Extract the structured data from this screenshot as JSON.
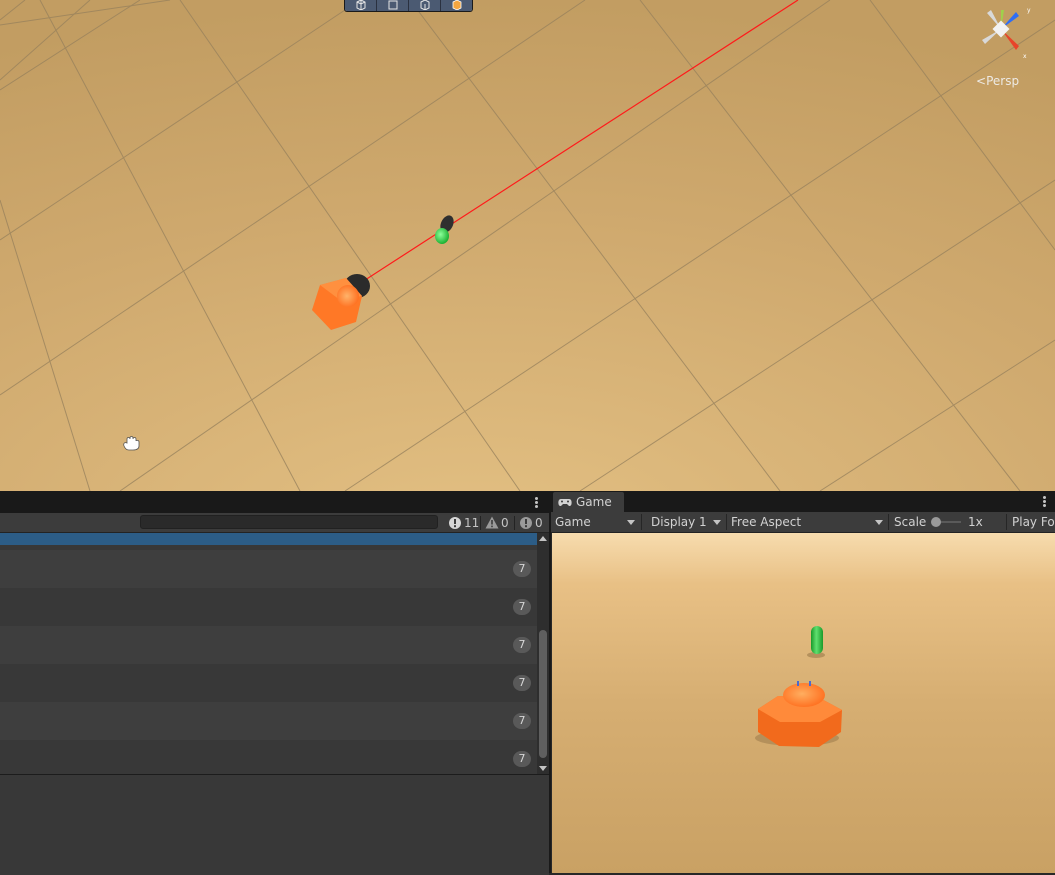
{
  "scene": {
    "persp_label": "Persp",
    "toolbar_icons": [
      "wireframe-cube-icon",
      "rect-tool-icon",
      "shaded-cube-icon",
      "lit-cube-icon"
    ],
    "gizmo_axes": {
      "y": "y",
      "x": "x"
    },
    "colors": {
      "ground": "#c9a46a",
      "grid": "#8f7a55",
      "ray": "#ff0000",
      "tank": "#ff6a1a",
      "target": "#22c43a"
    }
  },
  "console": {
    "search_placeholder": "",
    "counts": {
      "log": "11",
      "warning": "0",
      "error": "0"
    },
    "rows": [
      {
        "count": "7"
      },
      {
        "count": "7"
      },
      {
        "count": "7"
      },
      {
        "count": "7"
      },
      {
        "count": "7"
      },
      {
        "count": "7"
      }
    ]
  },
  "game": {
    "tab_label": "Game",
    "view_mode": "Game",
    "display": "Display 1",
    "aspect": "Free Aspect",
    "scale_label": "Scale",
    "scale_value": "1x",
    "play_focused": "Play Fo"
  }
}
